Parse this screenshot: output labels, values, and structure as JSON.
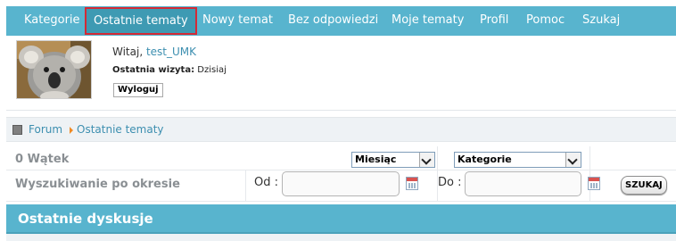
{
  "nav": {
    "items": [
      {
        "label": "Kategorie"
      },
      {
        "label": "Ostatnie tematy",
        "active": true
      },
      {
        "label": "Nowy temat"
      },
      {
        "label": "Bez odpowiedzi"
      },
      {
        "label": "Moje tematy"
      },
      {
        "label": "Profil"
      },
      {
        "label": "Pomoc"
      },
      {
        "label": "Szukaj"
      }
    ]
  },
  "user": {
    "welcome_prefix": "Witaj, ",
    "username": "test_UMK",
    "last_visit_label": "Ostatnia wizyta:",
    "last_visit_value": " Dzisiaj",
    "logout_label": "Wyloguj",
    "avatar_icon": "koala-avatar"
  },
  "breadcrumb": {
    "items": [
      "Forum",
      "Ostatnie tematy"
    ]
  },
  "filters": {
    "thread_count": "0 Wątek",
    "period_label": "Wyszukiwanie po okresie",
    "period_select": "Miesiąc",
    "category_select": "Kategorie",
    "from_label": "Od :",
    "to_label": "Do :",
    "search_button": "SZUKAJ"
  },
  "section": {
    "title": "Ostatnie dyskusje"
  },
  "colors": {
    "nav_bg": "#58b4ce",
    "nav_active_bg": "#3e9ab3",
    "nav_active_border": "#d42a35",
    "link": "#3d8fb0",
    "crumb_arrow": "#f08a24"
  }
}
